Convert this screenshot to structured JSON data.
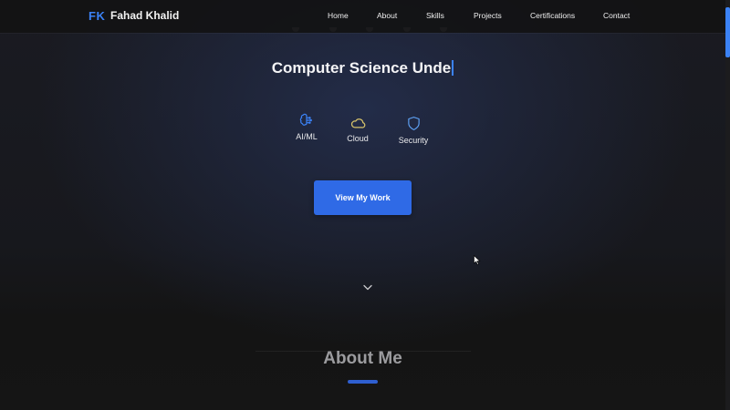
{
  "brand": {
    "logo": "FK",
    "name": "Fahad Khalid"
  },
  "nav": {
    "links": [
      "Home",
      "About",
      "Skills",
      "Projects",
      "Certifications",
      "Contact"
    ]
  },
  "hero": {
    "typed_text": "Computer Science Unde",
    "interests": [
      {
        "label": "AI/ML",
        "icon": "brain-icon",
        "color": "#3b82f6"
      },
      {
        "label": "Cloud",
        "icon": "cloud-icon",
        "color": "#d6c26a"
      },
      {
        "label": "Security",
        "icon": "shield-icon",
        "color": "#60a5fa"
      }
    ],
    "cta_label": "View My Work",
    "scroll_icon": "chevron-down-icon"
  },
  "about": {
    "title": "About Me"
  },
  "colors": {
    "accent": "#3b82f6",
    "button": "#2f6ae6",
    "background": "#141414"
  }
}
